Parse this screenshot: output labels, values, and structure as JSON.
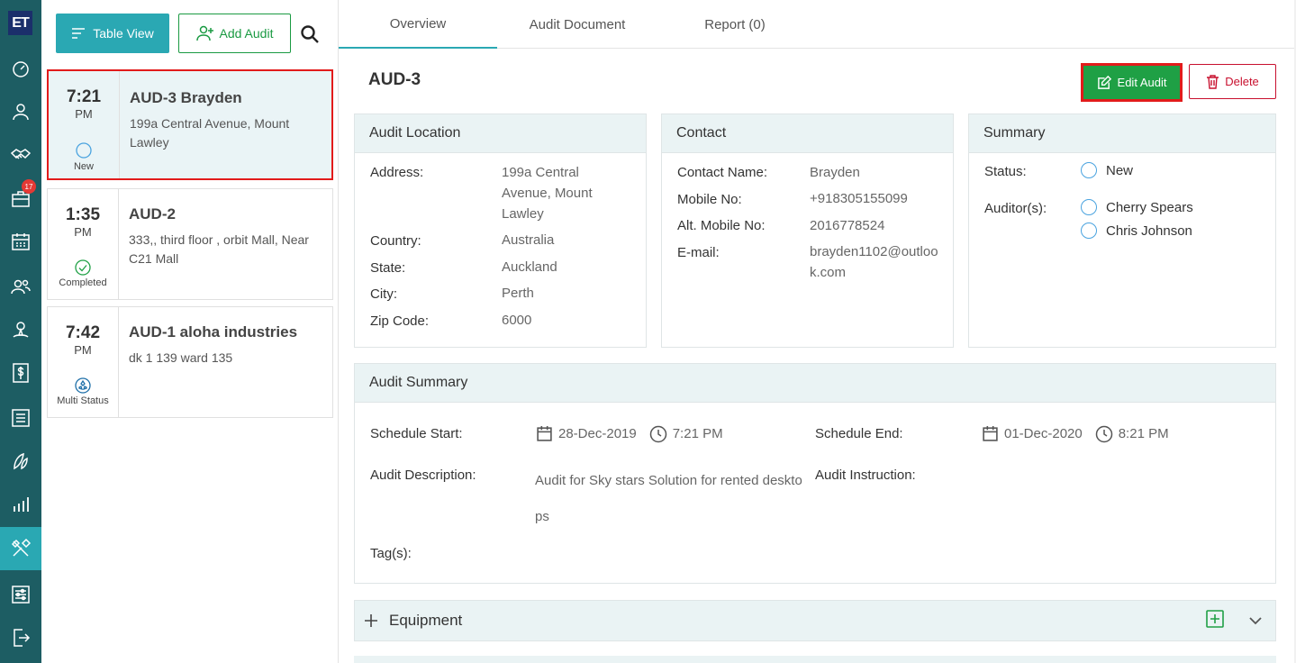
{
  "sidebar": {
    "logo": "ET",
    "badge_count": "17",
    "items": [
      {
        "icon": "dashboard-icon"
      },
      {
        "icon": "user-icon"
      },
      {
        "icon": "handshake-icon"
      },
      {
        "icon": "briefcase-icon"
      },
      {
        "icon": "calendar-icon"
      },
      {
        "icon": "users-icon"
      },
      {
        "icon": "location-person-icon"
      },
      {
        "icon": "dollar-icon"
      },
      {
        "icon": "list-icon"
      },
      {
        "icon": "leaf-icon"
      },
      {
        "icon": "bar-chart-icon"
      },
      {
        "icon": "tools-icon"
      },
      {
        "icon": "settings-sliders-icon"
      },
      {
        "icon": "logout-icon"
      }
    ]
  },
  "toolbar": {
    "table_view_label": "Table View",
    "add_audit_label": "Add Audit"
  },
  "audits": [
    {
      "time": "7:21",
      "ampm": "PM",
      "status": "New",
      "title": "AUD-3 Brayden",
      "address": "199a Central Avenue, Mount Lawley"
    },
    {
      "time": "1:35",
      "ampm": "PM",
      "status": "Completed",
      "title": "AUD-2",
      "address": "333,, third floor , orbit Mall, Near C21 Mall"
    },
    {
      "time": "7:42",
      "ampm": "PM",
      "status": "Multi Status",
      "title": "AUD-1 aloha industries",
      "address": "dk 1 139 ward 135"
    }
  ],
  "tabs": [
    "Overview",
    "Audit Document",
    "Report (0)"
  ],
  "detail": {
    "title": "AUD-3",
    "edit_label": "Edit Audit",
    "delete_label": "Delete"
  },
  "location": {
    "heading": "Audit Location",
    "address_label": "Address:",
    "address": "199a Central Avenue, Mount Lawley",
    "country_label": "Country:",
    "country": "Australia",
    "state_label": "State:",
    "state": "Auckland",
    "city_label": "City:",
    "city": "Perth",
    "zip_label": "Zip Code:",
    "zip": "6000"
  },
  "contact": {
    "heading": "Contact",
    "name_label": "Contact Name:",
    "name": "Brayden",
    "mobile_label": "Mobile No:",
    "mobile": "+918305155099",
    "alt_label": "Alt. Mobile No:",
    "alt": "2016778524",
    "email_label": "E-mail:",
    "email": "brayden1102@outlook.com"
  },
  "summary": {
    "heading": "Summary",
    "status_label": "Status:",
    "status": "New",
    "auditors_label": "Auditor(s):",
    "auditors": [
      "Cherry Spears",
      "Chris Johnson"
    ]
  },
  "audit_summary": {
    "heading": "Audit Summary",
    "start_label": "Schedule Start:",
    "start_date": "28-Dec-2019",
    "start_time": "7:21 PM",
    "end_label": "Schedule End:",
    "end_date": "01-Dec-2020",
    "end_time": "8:21 PM",
    "description_label": "Audit Description:",
    "description": "Audit for Sky stars Solution for rented desktops",
    "instruction_label": "Audit Instruction:",
    "tags_label": "Tag(s):"
  },
  "equipment": {
    "heading": "Equipment"
  }
}
